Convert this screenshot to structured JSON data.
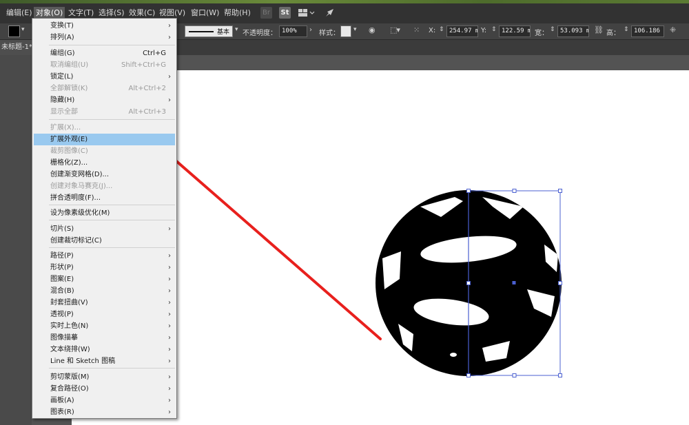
{
  "menubar": {
    "items": [
      {
        "label": "编辑(E)"
      },
      {
        "label": "对象(O)"
      },
      {
        "label": "文字(T)"
      },
      {
        "label": "选择(S)"
      },
      {
        "label": "效果(C)"
      },
      {
        "label": "视图(V)"
      },
      {
        "label": "窗口(W)"
      },
      {
        "label": "帮助(H)"
      }
    ],
    "app_icons": {
      "br": "Br",
      "st": "St",
      "layout": "layout-grid-icon",
      "send": "rocket-icon"
    }
  },
  "controlbar": {
    "stroke_style": "基本",
    "opacity_label": "不透明度：",
    "opacity_value": "100%",
    "style_label": "样式：",
    "x_label": "X:",
    "x_value": "254.97 mm",
    "y_label": "Y:",
    "y_value": "122.59 mm",
    "w_label": "宽：",
    "w_value": "53.093 mm",
    "h_label": "高：",
    "h_value": "106.186 m"
  },
  "tabbar": {
    "doc_title": "未标题-1* @"
  },
  "object_menu": {
    "items": [
      {
        "label": "变换(T)",
        "shortcut": "",
        "submenu": true,
        "disabled": false
      },
      {
        "label": "排列(A)",
        "shortcut": "",
        "submenu": true,
        "disabled": false
      },
      {
        "label": "编组(G)",
        "shortcut": "Ctrl+G",
        "submenu": false,
        "disabled": false
      },
      {
        "label": "取消编组(U)",
        "shortcut": "Shift+Ctrl+G",
        "submenu": false,
        "disabled": true
      },
      {
        "label": "锁定(L)",
        "shortcut": "",
        "submenu": true,
        "disabled": false
      },
      {
        "label": "全部解锁(K)",
        "shortcut": "Alt+Ctrl+2",
        "submenu": false,
        "disabled": true
      },
      {
        "label": "隐藏(H)",
        "shortcut": "",
        "submenu": true,
        "disabled": false
      },
      {
        "label": "显示全部",
        "shortcut": "Alt+Ctrl+3",
        "submenu": false,
        "disabled": true
      },
      {
        "label": "扩展(X)...",
        "shortcut": "",
        "submenu": false,
        "disabled": true
      },
      {
        "label": "扩展外观(E)",
        "shortcut": "",
        "submenu": false,
        "disabled": false,
        "highlighted": true
      },
      {
        "label": "裁剪图像(C)",
        "shortcut": "",
        "submenu": false,
        "disabled": true
      },
      {
        "label": "栅格化(Z)...",
        "shortcut": "",
        "submenu": false,
        "disabled": false
      },
      {
        "label": "创建渐变网格(D)...",
        "shortcut": "",
        "submenu": false,
        "disabled": false
      },
      {
        "label": "创建对象马赛克(J)...",
        "shortcut": "",
        "submenu": false,
        "disabled": true
      },
      {
        "label": "拼合透明度(F)...",
        "shortcut": "",
        "submenu": false,
        "disabled": false
      },
      {
        "label": "设为像素级优化(M)",
        "shortcut": "",
        "submenu": false,
        "disabled": false
      },
      {
        "label": "切片(S)",
        "shortcut": "",
        "submenu": true,
        "disabled": false
      },
      {
        "label": "创建裁切标记(C)",
        "shortcut": "",
        "submenu": false,
        "disabled": false
      },
      {
        "label": "路径(P)",
        "shortcut": "",
        "submenu": true,
        "disabled": false
      },
      {
        "label": "形状(P)",
        "shortcut": "",
        "submenu": true,
        "disabled": false
      },
      {
        "label": "图案(E)",
        "shortcut": "",
        "submenu": true,
        "disabled": false
      },
      {
        "label": "混合(B)",
        "shortcut": "",
        "submenu": true,
        "disabled": false
      },
      {
        "label": "封套扭曲(V)",
        "shortcut": "",
        "submenu": true,
        "disabled": false
      },
      {
        "label": "透视(P)",
        "shortcut": "",
        "submenu": true,
        "disabled": false
      },
      {
        "label": "实时上色(N)",
        "shortcut": "",
        "submenu": true,
        "disabled": false
      },
      {
        "label": "图像描摹",
        "shortcut": "",
        "submenu": true,
        "disabled": false
      },
      {
        "label": "文本绕排(W)",
        "shortcut": "",
        "submenu": true,
        "disabled": false
      },
      {
        "label": "Line 和 Sketch 图稿",
        "shortcut": "",
        "submenu": true,
        "disabled": false
      },
      {
        "label": "剪切蒙版(M)",
        "shortcut": "",
        "submenu": true,
        "disabled": false
      },
      {
        "label": "复合路径(O)",
        "shortcut": "",
        "submenu": true,
        "disabled": false
      },
      {
        "label": "画板(A)",
        "shortcut": "",
        "submenu": true,
        "disabled": false
      },
      {
        "label": "图表(R)",
        "shortcut": "",
        "submenu": true,
        "disabled": false
      }
    ]
  },
  "colors": {
    "highlight": "#99c9ef",
    "arrow": "#e8201d",
    "selection": "#4a5fd0"
  }
}
